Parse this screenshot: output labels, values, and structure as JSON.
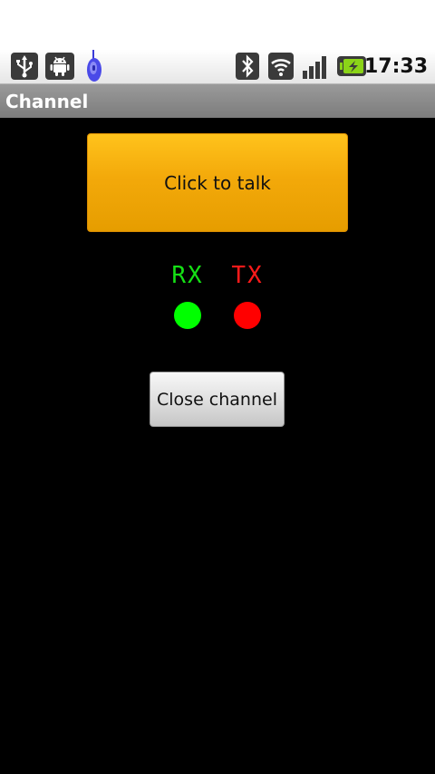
{
  "status_bar": {
    "icons_left": [
      "usb-icon",
      "android-debug-icon",
      "walkie-talkie-icon"
    ],
    "icons_right": [
      "bluetooth-icon",
      "wifi-icon",
      "signal-icon",
      "battery-charging-icon"
    ],
    "time": "17:33"
  },
  "title_bar": {
    "title": "Channel"
  },
  "main": {
    "talk_button_label": "Click to talk",
    "rx_label": "RX",
    "tx_label": "TX",
    "close_button_label": "Close channel"
  },
  "colors": {
    "talk_button": "#f3a90a",
    "rx_led": "#00ff00",
    "tx_led": "#ff0000",
    "background": "#000000"
  }
}
